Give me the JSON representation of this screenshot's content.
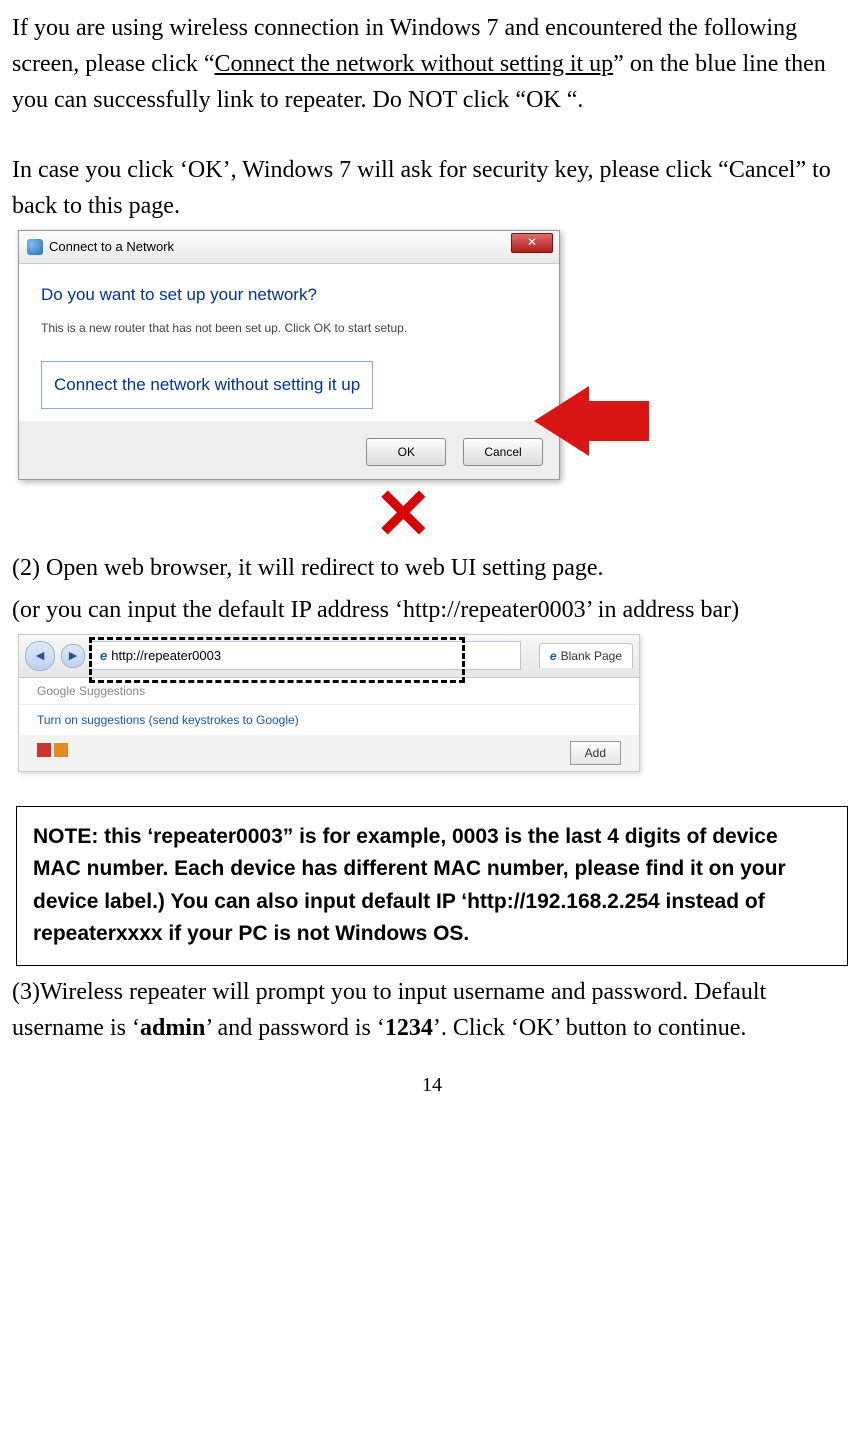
{
  "para1_a": "If you are using wireless connection in Windows 7 and encountered the following screen, please click “",
  "para1_link": "Connect the network without setting it up",
  "para1_b": "” on the blue line then you can successfully link to repeater. Do NOT click “OK “.",
  "para2": "In case you click ‘OK’, Windows 7 will ask for security key, please click “Cancel” to back to this page.",
  "dialog": {
    "title": "Connect to a Network",
    "question": "Do you want to set up your network?",
    "sub": "This is a new router that has not been set up. Click OK to start setup.",
    "link": "Connect the network without setting it up",
    "ok": "OK",
    "cancel": "Cancel"
  },
  "para3": "(2) Open web browser, it will redirect to web UI setting page.",
  "para4": "(or you can input the default IP address ‘http://repeater0003’ in address bar)",
  "browser": {
    "url": "http://repeater0003",
    "tab": "Blank Page",
    "suggest_header": "Google Suggestions",
    "suggest_text": "Turn on suggestions (send keystrokes to Google)",
    "add": "Add"
  },
  "note": "NOTE: this ‘repeater0003” is for example, 0003 is the last 4 digits of device MAC number. Each device has different MAC number, please find it on your device label.) You can also input default IP ‘http://192.168.2.254 instead of repeaterxxxx if your PC is not Windows OS.",
  "para5_a": "(3)Wireless repeater will prompt you to input username and password. Default username is ‘",
  "para5_admin": "admin",
  "para5_b": "’ and password is ‘",
  "para5_pw": "1234",
  "para5_c": "’. Click ‘OK’ button to continue.",
  "page_number": "14"
}
